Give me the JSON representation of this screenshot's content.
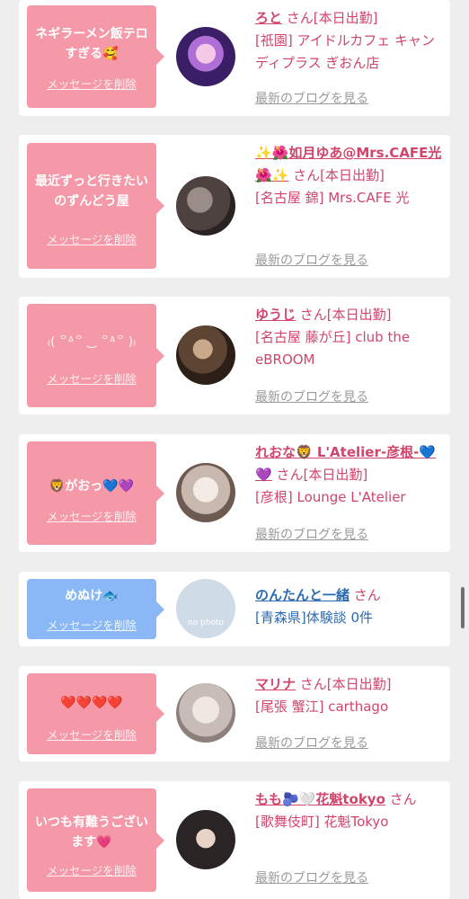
{
  "delete_label": "メッセージを削除",
  "blog_label": "最新のブログを見る",
  "colors": {
    "pink_bubble": "#f598a8",
    "blue_bubble": "#8ab8f6",
    "pink_text": "#d1456b",
    "blue_text": "#2a6bb3",
    "gray_text": "#9a9a9a"
  },
  "cards": [
    {
      "message": "ネギラーメン飯テロすぎる🥰",
      "name": "ろと",
      "suffix": "さん[本日出勤]",
      "shop": "[祇園] アイドルカフェ キャンディプラス ぎおん店",
      "avatar": "avatar-photo"
    },
    {
      "message": "最近ずっと行きたいのずんどう屋",
      "name": "✨🌺如月ゆあ@Mrs.CAFE光🌺✨",
      "suffix": "さん[本日出勤]",
      "shop": "[名古屋 錦] Mrs.CAFE 光",
      "avatar": "avatar-photo"
    },
    {
      "message": "₍( ꒪ᐞ꒪ ‿ ꒪ᐞ꒪ )₎",
      "name": "ゆうじ",
      "suffix": "さん[本日出勤]",
      "shop": "[名古屋 藤が丘] club the eBROOM",
      "avatar": "avatar-photo"
    },
    {
      "message": "🦁がおっ💙💜",
      "name": "れおな🦁 L'Atelier-彦根-💙💜",
      "suffix": "さん[本日出勤]",
      "shop": "[彦根] Lounge L'Atelier",
      "avatar": "avatar-photo"
    },
    {
      "message": "めぬけ🐟",
      "name": "のんたんと一緒",
      "suffix": "さん",
      "shop": "[青森県]体験談 0件",
      "avatar_text": "no photo"
    },
    {
      "message": "❤️❤️❤️❤️",
      "name": "マリナ",
      "suffix": "さん[本日出勤]",
      "shop": "[尾張 蟹江] carthago",
      "avatar": "avatar-photo"
    },
    {
      "message": "いつも有難うございます💗",
      "name": "もも🫐🤍花魁tokyo",
      "suffix": "さん",
      "shop": "[歌舞伎町] 花魁Tokyo",
      "avatar": "avatar-photo"
    }
  ]
}
